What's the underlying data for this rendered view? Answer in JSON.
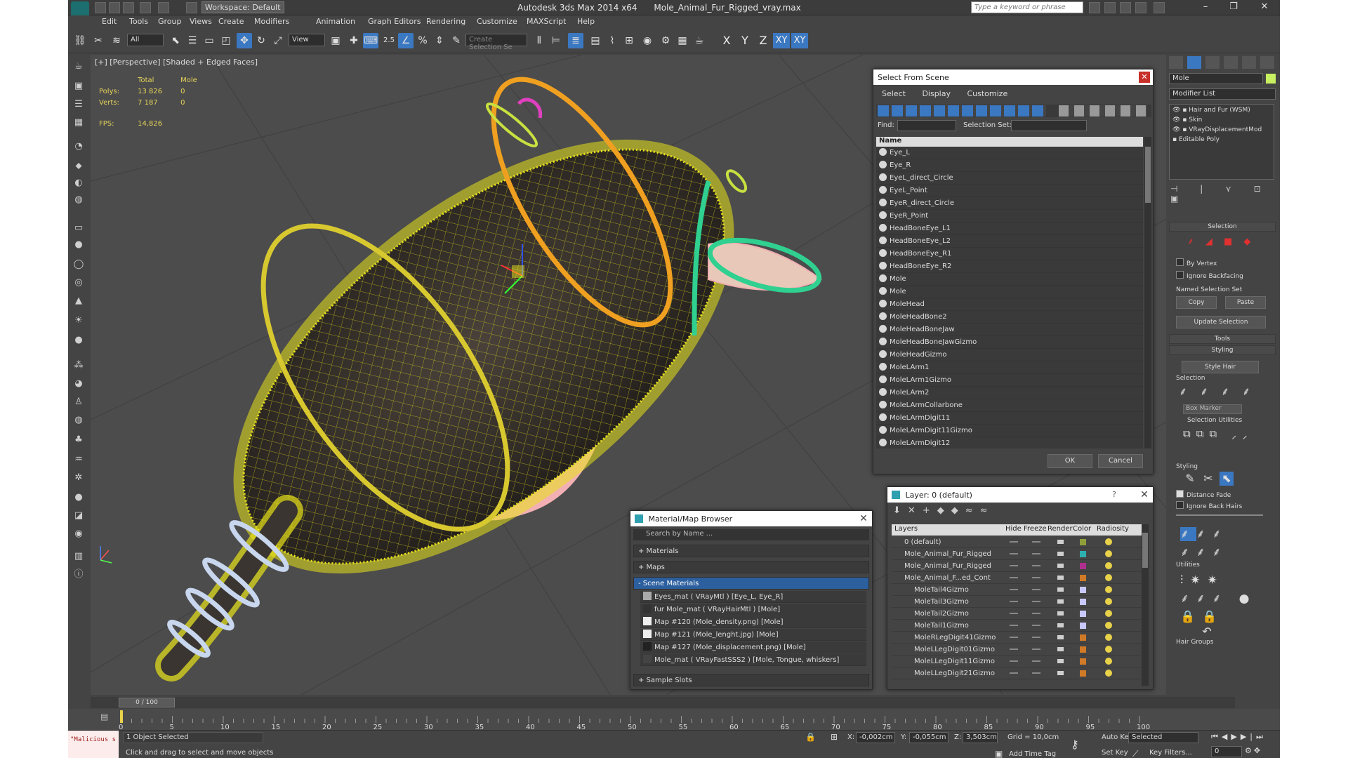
{
  "titlebar": {
    "app": "Autodesk 3ds Max  2014 x64",
    "file": "Mole_Animal_Fur_Rigged_vray.max",
    "workspace": "Workspace: Default",
    "search_placeholder": "Type a keyword or phrase"
  },
  "menu": [
    "Edit",
    "Tools",
    "Group",
    "Views",
    "Create",
    "Modifiers",
    "Animation",
    "Graph Editors",
    "Rendering",
    "Customize",
    "MAXScript",
    "Help"
  ],
  "toolbar": {
    "filter_select": "All",
    "refcoord_select": "View",
    "snap_label": "2.5",
    "named_sel_placeholder": "Create Selection Se",
    "axes": [
      "X",
      "Y",
      "Z",
      "XY",
      "XY"
    ]
  },
  "viewport": {
    "label": "[+] [Perspective] [Shaded + Edged Faces]",
    "stats": {
      "header_total": "Total",
      "header_obj": "Mole",
      "polys_label": "Polys:",
      "polys_total": "13 826",
      "polys_obj": "0",
      "verts_label": "Verts:",
      "verts_total": "7 187",
      "verts_obj": "0",
      "fps_label": "FPS:",
      "fps_value": "14,826"
    },
    "colors": {
      "wire": "#e8e21a",
      "body_dark": "#2f2a25",
      "ring_orange": "#f0a020",
      "ring_yellow": "#d8c830",
      "ring_green": "#30d090",
      "ring_white": "#c8d6ee",
      "pink": "#f2b0b4"
    }
  },
  "select_from_scene": {
    "title": "Select From Scene",
    "tabs": [
      "Select",
      "Display",
      "Customize"
    ],
    "find_label": "Find:",
    "selection_set_label": "Selection Set:",
    "column_name": "Name",
    "items": [
      "Eye_L",
      "Eye_R",
      "EyeL_direct_Circle",
      "EyeL_Point",
      "EyeR_direct_Circle",
      "EyeR_Point",
      "HeadBoneEye_L1",
      "HeadBoneEye_L2",
      "HeadBoneEye_R1",
      "HeadBoneEye_R2",
      "Mole",
      "Mole",
      "MoleHead",
      "MoleHeadBone2",
      "MoleHeadBoneJaw",
      "MoleHeadBoneJawGizmo",
      "MoleHeadGizmo",
      "MoleLArm1",
      "MoleLArm1Gizmo",
      "MoleLArm2",
      "MoleLArmCollarbone",
      "MoleLArmDigit11",
      "MoleLArmDigit11Gizmo",
      "MoleLArmDigit12"
    ],
    "ok": "OK",
    "cancel": "Cancel"
  },
  "material_browser": {
    "title": "Material/Map Browser",
    "search_placeholder": "Search by Name ...",
    "sections": [
      "+ Materials",
      "+ Maps",
      "- Scene Materials",
      "+ Sample Slots"
    ],
    "items": [
      "Eyes_mat  ( VRayMtl )  [Eye_L, Eye_R]",
      "fur Mole_mat  ( VRayHairMtl )  [Mole]",
      "Map #120 (Mole_density.png)  [Mole]",
      "Map #121 (Mole_lenght.jpg)  [Mole]",
      "Map #127 (Mole_displacement.png)  [Mole]",
      "Mole_mat  ( VRayFastSSS2 )  [Mole, Tongue, whiskers]"
    ]
  },
  "layers": {
    "title": "Layer: 0 (default)",
    "help": "?",
    "columns": [
      "Layers",
      "Hide",
      "Freeze",
      "Render",
      "Color",
      "Radiosity"
    ],
    "rows": [
      {
        "name": "0 (default)",
        "color": "#8fa03a"
      },
      {
        "name": "Mole_Animal_Fur_Rigged",
        "color": "#2fb0b0"
      },
      {
        "name": "Mole_Animal_Fur_Rigged",
        "color": "#b02f8e"
      },
      {
        "name": "Mole_Animal_F...ed_Cont",
        "color": "#d07a28"
      },
      {
        "name": "MoleTail4Gizmo",
        "color": "#c8c8ff"
      },
      {
        "name": "MoleTail3Gizmo",
        "color": "#c8c8ff"
      },
      {
        "name": "MoleTail2Gizmo",
        "color": "#c8c8ff"
      },
      {
        "name": "MoleTail1Gizmo",
        "color": "#c8c8ff"
      },
      {
        "name": "MoleRLegDigit41Gizmo",
        "color": "#d07a28"
      },
      {
        "name": "MoleLLegDigit01Gizmo",
        "color": "#d07a28"
      },
      {
        "name": "MoleLLegDigit11Gizmo",
        "color": "#d07a28"
      },
      {
        "name": "MoleLLegDigit21Gizmo",
        "color": "#d07a28"
      }
    ]
  },
  "command_panel": {
    "object_name": "Mole",
    "modifier_list": "Modifier List",
    "stack": [
      "Hair and Fur (WSM)",
      "Skin",
      "VRayDisplacementMod",
      "Editable Poly"
    ],
    "selection_rollout": "Selection",
    "by_vertex": "By Vertex",
    "ignore_backfacing": "Ignore Backfacing",
    "named_selection_set": "Named Selection Set",
    "copy": "Copy",
    "paste": "Paste",
    "update_selection": "Update Selection",
    "tools_rollout": "Tools",
    "styling_rollout": "Styling",
    "style_hair": "Style Hair",
    "selection_group": "Selection",
    "box_marker": "Box Marker",
    "selection_utilities": "Selection Utilities",
    "styling_group": "Styling",
    "distance_fade": "Distance Fade",
    "ignore_back_hairs": "Ignore Back Hairs",
    "utilities": "Utilities",
    "hair_groups": "Hair Groups"
  },
  "timeline": {
    "frame": "0 / 100",
    "ticks": [
      "0",
      "5",
      "10",
      "15",
      "20",
      "25",
      "30",
      "35",
      "40",
      "45",
      "50",
      "55",
      "60",
      "65",
      "70",
      "75",
      "80",
      "85",
      "90",
      "95",
      "100"
    ]
  },
  "status": {
    "script_listener": "\"Malicious s",
    "selected": "1 Object Selected",
    "prompt": "Click and drag to select and move objects",
    "x_label": "X:",
    "x_value": "-0,002cm",
    "y_label": "Y:",
    "y_value": "-0,055cm",
    "z_label": "Z:",
    "z_value": "3,503cm",
    "grid": "Grid = 10,0cm",
    "add_time_tag": "Add Time Tag",
    "auto_key": "Auto Key",
    "set_key": "Set Key",
    "selected_select": "Selected",
    "key_filters": "Key Filters...",
    "frame_field": "0"
  }
}
